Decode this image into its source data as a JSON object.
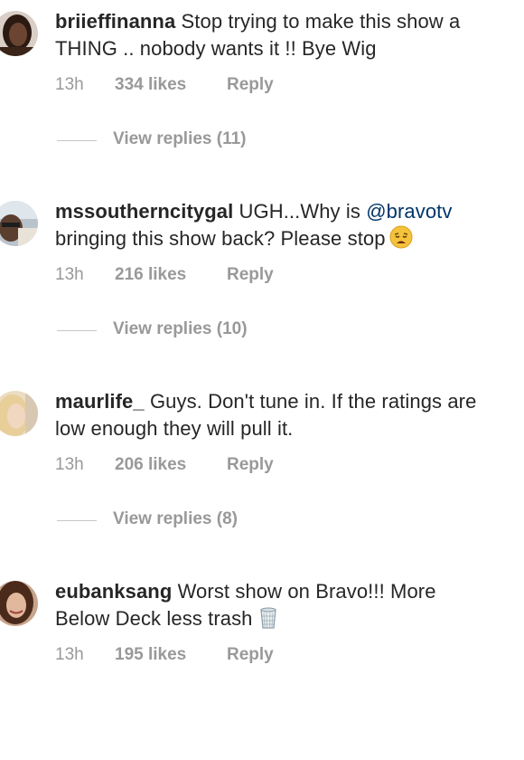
{
  "comments": [
    {
      "username": "briieffinanna",
      "line1": "Stop trying to make this show a",
      "line2": "THING .. nobody wants it !! Bye Wig",
      "time": "13h",
      "likes": "334 likes",
      "reply": "Reply",
      "view_replies": "View replies (11)"
    },
    {
      "username": "mssoutherncitygal",
      "line1_pre": "UGH...Why is",
      "mention": "@bravotv",
      "line2": "bringing this show back? Please stop",
      "emoji": "weary-face-emoji",
      "time": "13h",
      "likes": "216 likes",
      "reply": "Reply",
      "view_replies": "View replies (10)"
    },
    {
      "username": "maurlife_",
      "line1": "Guys. Don't tune in. If the ratings are",
      "line2": "low enough they will pull it.",
      "time": "13h",
      "likes": "206 likes",
      "reply": "Reply",
      "view_replies": "View replies (8)"
    },
    {
      "username": "eubanksang",
      "line1": "Worst show on Bravo!!! More",
      "line2": "Below Deck less trash",
      "emoji": "wastebasket-emoji",
      "time": "13h",
      "likes": "195 likes",
      "reply": "Reply"
    }
  ],
  "colors": {
    "text": "#262626",
    "meta": "#999999",
    "mention": "#003569",
    "divider": "#c7c7c7"
  }
}
